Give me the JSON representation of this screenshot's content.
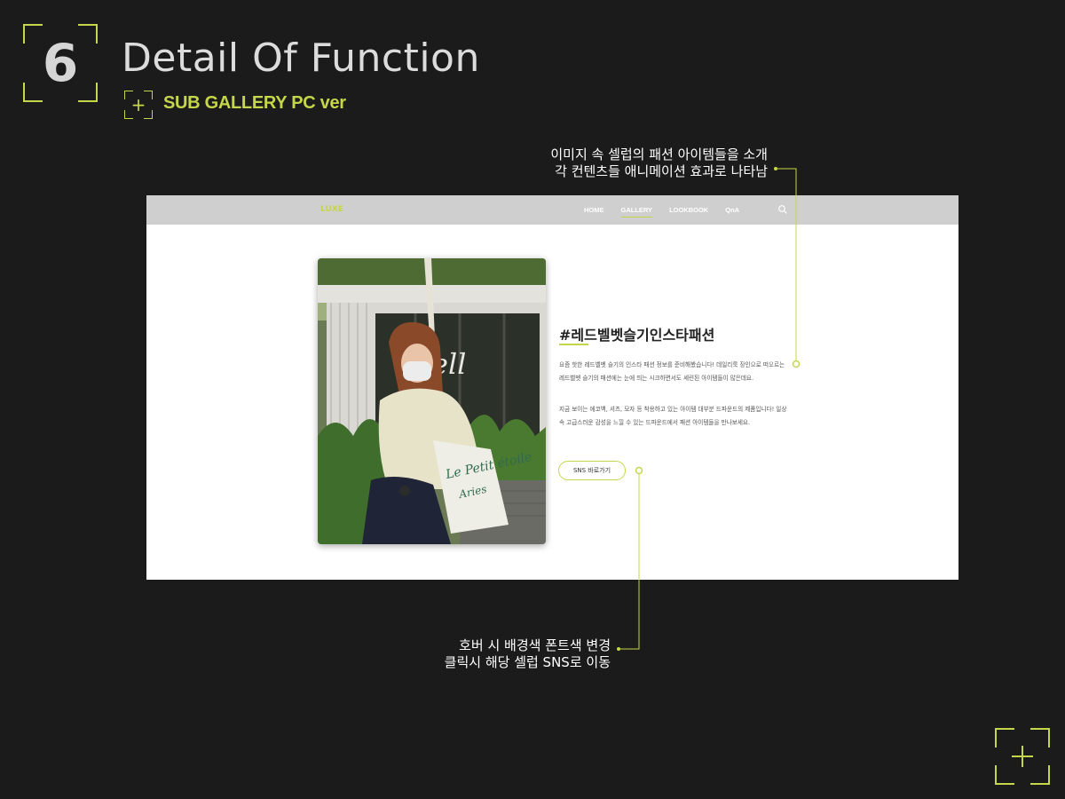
{
  "header": {
    "section_number": "6",
    "title": "Detail Of Function",
    "subtitle": "SUB GALLERY PC ver"
  },
  "annotations": {
    "top": [
      "이미지 속 셀럽의 패션 아이템들을 소개",
      "각 컨텐츠들 애니메이션 효과로 나타남"
    ],
    "bottom": [
      "호버 시 배경색 폰트색 변경",
      "클릭시 해당 셀럽 SNS로 이동"
    ]
  },
  "site": {
    "logo": "LUXE",
    "nav": [
      "HOME",
      "GALLERY",
      "LOOKBOOK",
      "QnA"
    ],
    "active_nav": "GALLERY",
    "content_title": "#레드벨벳슬기인스타패션",
    "paragraph1": "요즘 핫한 레드벨벳 슬기의 인스타 패션 정보를 준비해봤습니다! 데일리룩 장인으로 떠오르는 레드벨벳 슬기의 패션에는 눈에 띄는 시크하면서도 세련된 아이템들이 많은데요.",
    "paragraph2": "지금 보이는 에코백, 셔츠, 모자 등 착용하고 있는 아이템 대부분 드파운드의 제품입니다! 일상 속 고급스러운 감성을 느낄 수 있는 드파운드에서 패션 아이템들을 만나보세요.",
    "sns_button": "SNS 바로가기",
    "photo_bag_text": [
      "Le Petit étoile",
      "Aries"
    ],
    "photo_wall_text": "ell"
  },
  "colors": {
    "accent": "#c6d64a",
    "background": "#1b1b1b",
    "nav_bg": "#cfcfcf"
  },
  "icons": [
    "plus-icon",
    "search-icon"
  ]
}
